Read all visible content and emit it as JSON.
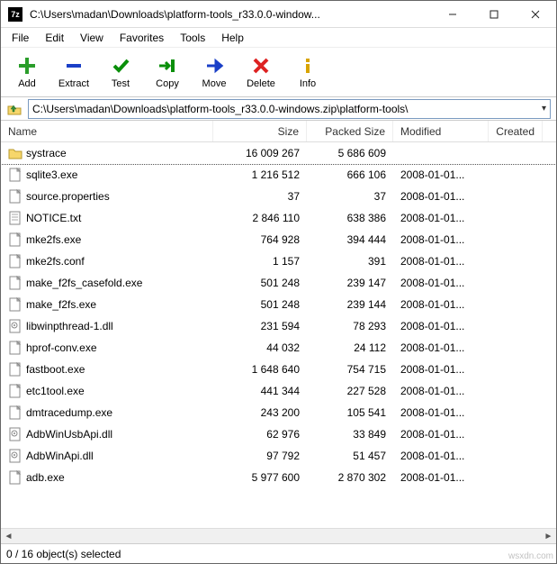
{
  "window": {
    "title": "C:\\Users\\madan\\Downloads\\platform-tools_r33.0.0-window...",
    "app_icon_label": "7z"
  },
  "menu": [
    "File",
    "Edit",
    "View",
    "Favorites",
    "Tools",
    "Help"
  ],
  "toolbar": [
    {
      "id": "add",
      "label": "Add",
      "icon": "plus",
      "color": "#2a9d2a"
    },
    {
      "id": "extract",
      "label": "Extract",
      "icon": "minus",
      "color": "#1a3fc7"
    },
    {
      "id": "test",
      "label": "Test",
      "icon": "check",
      "color": "#0a8f0a"
    },
    {
      "id": "copy",
      "label": "Copy",
      "icon": "copy",
      "color": "#0a8f0a"
    },
    {
      "id": "move",
      "label": "Move",
      "icon": "move",
      "color": "#1a3fc7"
    },
    {
      "id": "delete",
      "label": "Delete",
      "icon": "x",
      "color": "#d22"
    },
    {
      "id": "info",
      "label": "Info",
      "icon": "info",
      "color": "#d8a400"
    }
  ],
  "address": {
    "path": "C:\\Users\\madan\\Downloads\\platform-tools_r33.0.0-windows.zip\\platform-tools\\"
  },
  "columns": [
    {
      "id": "name",
      "label": "Name"
    },
    {
      "id": "size",
      "label": "Size"
    },
    {
      "id": "psize",
      "label": "Packed Size"
    },
    {
      "id": "modified",
      "label": "Modified"
    },
    {
      "id": "created",
      "label": "Created"
    }
  ],
  "files": [
    {
      "icon": "folder",
      "name": "systrace",
      "size": "16 009 267",
      "psize": "5 686 609",
      "modified": "",
      "selected": true
    },
    {
      "icon": "exe",
      "name": "sqlite3.exe",
      "size": "1 216 512",
      "psize": "666 106",
      "modified": "2008-01-01..."
    },
    {
      "icon": "txt",
      "name": "source.properties",
      "size": "37",
      "psize": "37",
      "modified": "2008-01-01..."
    },
    {
      "icon": "note",
      "name": "NOTICE.txt",
      "size": "2 846 110",
      "psize": "638 386",
      "modified": "2008-01-01..."
    },
    {
      "icon": "exe",
      "name": "mke2fs.exe",
      "size": "764 928",
      "psize": "394 444",
      "modified": "2008-01-01..."
    },
    {
      "icon": "txt",
      "name": "mke2fs.conf",
      "size": "1 157",
      "psize": "391",
      "modified": "2008-01-01..."
    },
    {
      "icon": "exe",
      "name": "make_f2fs_casefold.exe",
      "size": "501 248",
      "psize": "239 147",
      "modified": "2008-01-01..."
    },
    {
      "icon": "exe",
      "name": "make_f2fs.exe",
      "size": "501 248",
      "psize": "239 144",
      "modified": "2008-01-01..."
    },
    {
      "icon": "dll",
      "name": "libwinpthread-1.dll",
      "size": "231 594",
      "psize": "78 293",
      "modified": "2008-01-01..."
    },
    {
      "icon": "exe",
      "name": "hprof-conv.exe",
      "size": "44 032",
      "psize": "24 112",
      "modified": "2008-01-01..."
    },
    {
      "icon": "exe",
      "name": "fastboot.exe",
      "size": "1 648 640",
      "psize": "754 715",
      "modified": "2008-01-01..."
    },
    {
      "icon": "exe",
      "name": "etc1tool.exe",
      "size": "441 344",
      "psize": "227 528",
      "modified": "2008-01-01..."
    },
    {
      "icon": "exe",
      "name": "dmtracedump.exe",
      "size": "243 200",
      "psize": "105 541",
      "modified": "2008-01-01..."
    },
    {
      "icon": "dll",
      "name": "AdbWinUsbApi.dll",
      "size": "62 976",
      "psize": "33 849",
      "modified": "2008-01-01..."
    },
    {
      "icon": "dll",
      "name": "AdbWinApi.dll",
      "size": "97 792",
      "psize": "51 457",
      "modified": "2008-01-01..."
    },
    {
      "icon": "exe",
      "name": "adb.exe",
      "size": "5 977 600",
      "psize": "2 870 302",
      "modified": "2008-01-01..."
    }
  ],
  "status": "0 / 16 object(s) selected",
  "watermark": "wsxdn.com"
}
